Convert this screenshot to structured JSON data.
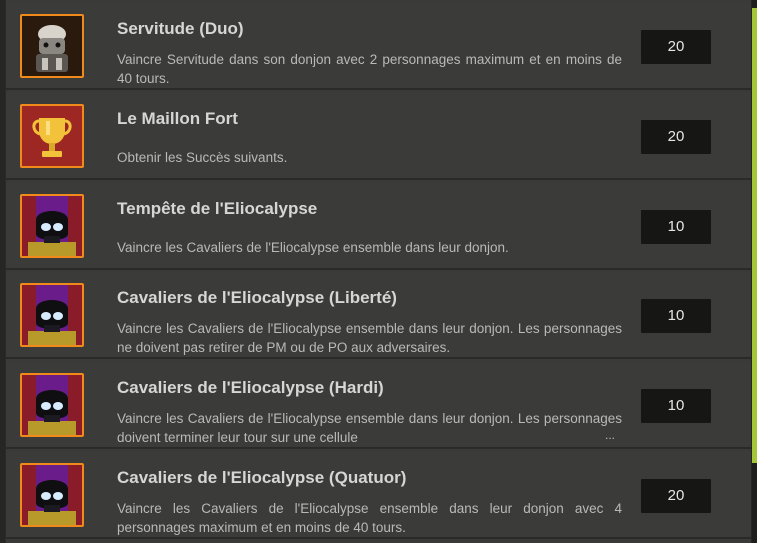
{
  "achievements": [
    {
      "title": "Servitude (Duo)",
      "description": "Vaincre Servitude dans son donjon avec 2 personnages maximum et en moins de 40 tours.",
      "points": "20",
      "icon": "servitude-boss-icon"
    },
    {
      "title": "Le Maillon Fort",
      "description": "Obtenir les Succès suivants.",
      "points": "20",
      "icon": "gold-trophy-icon"
    },
    {
      "title": "Tempête de l'Eliocalypse",
      "description": "Vaincre les Cavaliers de l'Eliocalypse ensemble dans leur donjon.",
      "points": "10",
      "icon": "eliocalypse-skull-icon"
    },
    {
      "title": "Cavaliers de l'Eliocalypse (Liberté)",
      "description": "Vaincre les Cavaliers de l'Eliocalypse ensemble dans leur donjon. Les personnages ne doivent pas retirer de PM ou de PO aux adversaires.",
      "points": "10",
      "icon": "eliocalypse-skull-icon"
    },
    {
      "title": "Cavaliers de l'Eliocalypse (Hardi)",
      "description": "Vaincre les Cavaliers de l'Eliocalypse ensemble dans leur donjon. Les personnages doivent terminer leur tour sur une cellule",
      "more": "...",
      "points": "10",
      "icon": "eliocalypse-skull-icon"
    },
    {
      "title": "Cavaliers de l'Eliocalypse (Quatuor)",
      "description": "Vaincre les Cavaliers de l'Eliocalypse ensemble dans leur donjon avec 4 personnages maximum et en moins de 40 tours.",
      "points": "20",
      "icon": "eliocalypse-skull-icon"
    }
  ],
  "colors": {
    "icon_border": "#f08a1a",
    "scrollbar_thumb": "#a6c63a",
    "points_background": "#161615"
  }
}
